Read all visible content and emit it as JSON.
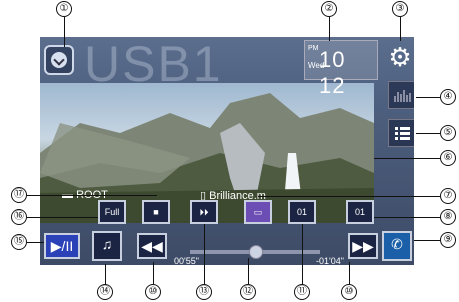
{
  "source": {
    "title": "USB1"
  },
  "clock": {
    "day": "Wed",
    "time": "10 12",
    "ampm": "PM"
  },
  "path": {
    "folder": "ROOT",
    "file": "Brilliance.m"
  },
  "controls": {
    "display_mode": "Full",
    "track_number": "01",
    "chapter_number": "01"
  },
  "playback": {
    "elapsed": "00'55\"",
    "remaining": "-01'04\"",
    "progress_fraction": 0.46
  },
  "callouts": [
    "①",
    "②",
    "③",
    "④",
    "⑤",
    "⑥",
    "⑦",
    "⑧",
    "⑨",
    "⑩",
    "⑪",
    "⑫",
    "⑬",
    "⑭",
    "⑮",
    "⑯",
    "⑰",
    "⑩"
  ],
  "colors": {
    "accent_play": "#2b41b8",
    "selected_control": "#6b4db3"
  }
}
